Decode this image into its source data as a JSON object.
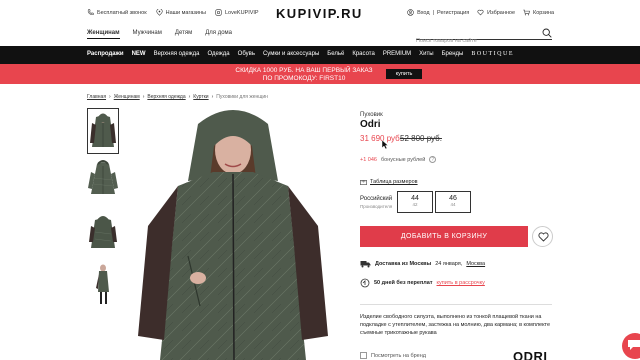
{
  "topbar": {
    "free_call": "Бесплатный звонок",
    "stores": "Наши магазины",
    "social": "LoveKUPIVIP",
    "logo": "KUPIVIP.RU",
    "login": "Вход",
    "separator": "|",
    "register": "Регистрация",
    "favorites": "Избранное",
    "cart": "Корзина"
  },
  "gender_nav": [
    "Женщинам",
    "Мужчинам",
    "Детям",
    "Для дома"
  ],
  "search": {
    "placeholder": "Поиск товаров на сайте"
  },
  "categories": [
    "Распродажи",
    "NEW",
    "Верхняя одежда",
    "Одежда",
    "Обувь",
    "Сумки и аксессуары",
    "Бельё",
    "Красота",
    "PREMIUM",
    "Хиты",
    "Бренды",
    "BOUTIQUE"
  ],
  "promo": {
    "line1": "СКИДКА 1000 РУБ. НА ВАШ ПЕРВЫЙ ЗАКАЗ",
    "line2": "ПО ПРОМОКОДУ: FIRST10",
    "button": "купить"
  },
  "breadcrumb": [
    "Главная",
    "Женщинам",
    "Верхняя одежда",
    "Куртки",
    "Пуховики для женщин"
  ],
  "product": {
    "type": "Пуховик",
    "brand": "Odri",
    "price_new": "31 690 руб.",
    "price_old": "52 800 руб.",
    "bonus_value": "+1 046",
    "bonus_label": "бонусные рублей",
    "bonus_help": "?",
    "size_table": "Таблица размеров",
    "size_region": "Российский",
    "size_region_sub": "Производителя",
    "sizes": [
      {
        "value": "44",
        "sub": "42"
      },
      {
        "value": "46",
        "sub": "44"
      }
    ],
    "add_to_cart": "ДОБАВИТЬ В КОРЗИНУ",
    "delivery_label": "Доставка из Москвы",
    "delivery_date": "24 января,",
    "delivery_city": "Москва",
    "return_label": "50 дней без переплат",
    "return_link": "купить в рассрочку",
    "description": "Изделие свободного силуэта, выполнено из тонкой плащевой ткани на подкладке с утеплителем, застежка на молнию, два кармана; в комплекте съемные трикотажные рукава",
    "extra_option": "Посмотреть на бренд",
    "brand_logo": "ODRI"
  },
  "colors": {
    "accent": "#e8454e",
    "catbar": "#111111",
    "jacket": "#4f5a4c"
  }
}
